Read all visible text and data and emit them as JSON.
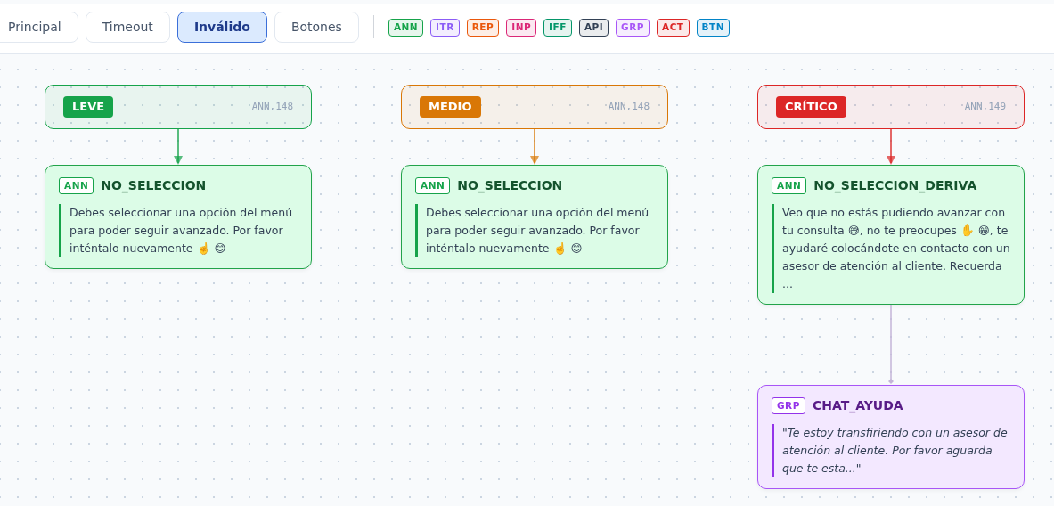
{
  "tabs": [
    {
      "label": "Principal",
      "selected": false
    },
    {
      "label": "Timeout",
      "selected": false
    },
    {
      "label": "Inválido",
      "selected": true
    },
    {
      "label": "Botones",
      "selected": false
    }
  ],
  "legend": [
    {
      "label": "ANN",
      "color": "#16a34a"
    },
    {
      "label": "ITR",
      "color": "#8b5cf6"
    },
    {
      "label": "REP",
      "color": "#ea580c"
    },
    {
      "label": "INP",
      "color": "#db2777"
    },
    {
      "label": "IFF",
      "color": "#059669"
    },
    {
      "label": "API",
      "color": "#334155"
    },
    {
      "label": "GRP",
      "color": "#a855f7"
    },
    {
      "label": "ACT",
      "color": "#dc2626"
    },
    {
      "label": "BTN",
      "color": "#0284c7"
    }
  ],
  "columns": [
    {
      "severity": {
        "label": "LEVE",
        "color": "#16a34a"
      },
      "ref": "ANN,148",
      "nodes": [
        {
          "kind": "message",
          "tag": "ANN",
          "title": "NO_SELECCION",
          "text": "Debes seleccionar una opción del menú para poder seguir avanzado. Por favor inténtalo nuevamente ☝️ 😊"
        }
      ]
    },
    {
      "severity": {
        "label": "MEDIO",
        "color": "#d97706"
      },
      "ref": "ANN,148",
      "nodes": [
        {
          "kind": "message",
          "tag": "ANN",
          "title": "NO_SELECCION",
          "text": "Debes seleccionar una opción del menú para poder seguir avanzado. Por favor inténtalo nuevamente ☝️ 😊"
        }
      ]
    },
    {
      "severity": {
        "label": "CRÍTICO",
        "color": "#dc2626"
      },
      "ref": "ANN,149",
      "nodes": [
        {
          "kind": "message",
          "tag": "ANN",
          "title": "NO_SELECCION_DERIVA",
          "text": "Veo que no estás pudiendo avanzar con tu consulta 😅, no te preocupes ✋ 😁, te ayudaré colocándote en contacto con un asesor de atención al cliente. Recuerda ..."
        },
        {
          "kind": "group",
          "tag": "GRP",
          "title": "CHAT_AYUDA",
          "text": "\"Te estoy transfiriendo con un asesor de atención al cliente. Por favor aguarda que te esta...\""
        }
      ]
    }
  ]
}
